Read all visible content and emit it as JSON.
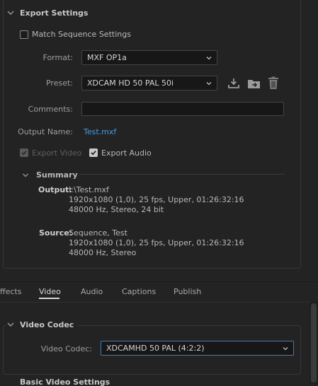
{
  "export_settings": {
    "title": "Export Settings",
    "match_sequence_label": "Match Sequence Settings",
    "format_label": "Format:",
    "format_value": "MXF OP1a",
    "preset_label": "Preset:",
    "preset_value": "XDCAM HD 50 PAL 50i",
    "comments_label": "Comments:",
    "comments_value": "",
    "output_name_label": "Output Name:",
    "output_name_value": "Test.mxf",
    "export_video_label": "Export Video",
    "export_audio_label": "Export Audio",
    "icons": [
      "save-preset-icon",
      "import-preset-icon",
      "delete-preset-icon"
    ]
  },
  "summary": {
    "title": "Summary",
    "output_label": "Output:",
    "output_lines": [
      "I:\\Test.mxf",
      "1920x1080 (1,0), 25 fps, Upper, 01:26:32:16",
      "48000 Hz, Stereo, 24 bit"
    ],
    "source_label": "Source:",
    "source_lines": [
      "Sequence, Test",
      "1920x1080 (1,0), 25 fps, Upper, 01:26:32:16",
      "48000 Hz, Stereo"
    ]
  },
  "tabs": [
    "ffects",
    "Video",
    "Audio",
    "Captions",
    "Publish"
  ],
  "video_codec": {
    "title": "Video Codec",
    "label": "Video Codec:",
    "value": "XDCAMHD 50 PAL (4:2:2)"
  },
  "next_section": "Basic Video Settings",
  "colors": {
    "accent": "#4a9bdc",
    "background": "#232323",
    "text": "#b9b9b9"
  }
}
